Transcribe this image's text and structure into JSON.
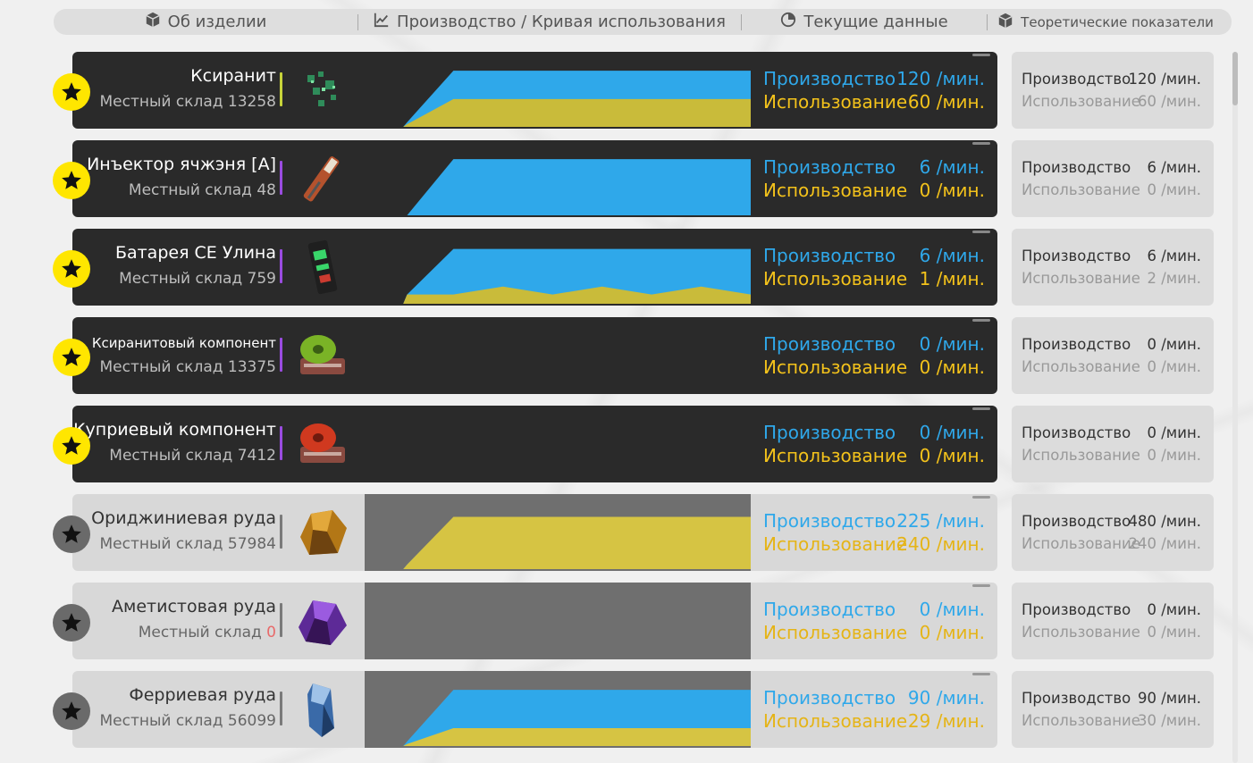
{
  "tabs": [
    {
      "icon": "box-icon",
      "label": "Об изделии"
    },
    {
      "icon": "line-chart-icon",
      "label": "Производство / Кривая использования"
    },
    {
      "icon": "pie-chart-icon",
      "label": "Текущие данные"
    },
    {
      "icon": "cube-icon",
      "label": "Теоретические показатели"
    }
  ],
  "colors": {
    "production": "#2fa8ea",
    "usage": "#f3c21b",
    "favorite_active": "#ffe600"
  },
  "items": [
    {
      "name": "Ксиранит",
      "stock_label": "Местный склад",
      "stock": "13258",
      "icon": "xiranite-crystal-icon",
      "production_label": "Производство",
      "production": "120",
      "usage_label": "Использование",
      "usage": "60",
      "unit": "/мин.",
      "theo_production": "120",
      "theo_usage": "60",
      "favorite": true,
      "curve": {
        "production": [
          0,
          0,
          0.07,
          0.85,
          0.85,
          0.85,
          0.85
        ],
        "usage": [
          0,
          0,
          0.04,
          0.42,
          0.42,
          0.42,
          0.42
        ]
      }
    },
    {
      "name": "Инъектор ячжэня [A]",
      "stock_label": "Местный склад",
      "stock": "48",
      "icon": "injector-icon",
      "production_label": "Производство",
      "production": "6",
      "usage_label": "Использование",
      "usage": "0",
      "unit": "/мин.",
      "theo_production": "6",
      "theo_usage": "0",
      "favorite": true,
      "curve": {
        "production": [
          0,
          0,
          0,
          0.85,
          0.85,
          0.85,
          0.85
        ],
        "usage": [
          0,
          0,
          0,
          0,
          0,
          0,
          0
        ]
      }
    },
    {
      "name": "Батарея СЕ Улина",
      "stock_label": "Местный склад",
      "stock": "759",
      "icon": "battery-icon",
      "production_label": "Производство",
      "production": "6",
      "usage_label": "Использование",
      "usage": "1",
      "unit": "/мин.",
      "theo_production": "6",
      "theo_usage": "2",
      "favorite": true,
      "curve": {
        "production": [
          0,
          0,
          0.14,
          0.83,
          0.83,
          0.83,
          0.83,
          0.83,
          0.83,
          0.83
        ],
        "usage": [
          0,
          0,
          0.14,
          0.14,
          0.26,
          0.14,
          0.26,
          0.14,
          0.26,
          0.14
        ]
      }
    },
    {
      "name": "Ксиранитовый компонент",
      "stock_label": "Местный склад",
      "stock": "13375",
      "icon": "xiranite-component-icon",
      "production_label": "Производство",
      "production": "0",
      "usage_label": "Использование",
      "usage": "0",
      "unit": "/мин.",
      "theo_production": "0",
      "theo_usage": "0",
      "favorite": true,
      "curve": null
    },
    {
      "name": "Куприевый компонент",
      "stock_label": "Местный склад",
      "stock": "7412",
      "icon": "cuprium-component-icon",
      "production_label": "Производство",
      "production": "0",
      "usage_label": "Использование",
      "usage": "0",
      "unit": "/мин.",
      "theo_production": "0",
      "theo_usage": "0",
      "favorite": true,
      "curve": null
    },
    {
      "name": "Ориджиниевая руда",
      "stock_label": "Местный склад",
      "stock": "57984",
      "icon": "originium-ore-icon",
      "production_label": "Производство",
      "production": "225",
      "usage_label": "Использование",
      "usage": "240",
      "unit": "/мин.",
      "theo_production": "480",
      "theo_usage": "240",
      "favorite": false,
      "curve": {
        "production": [
          0,
          0,
          0.07,
          0.78,
          0.79,
          0.76,
          0.73,
          0.72
        ],
        "usage": [
          0,
          0,
          0.07,
          0.79,
          0.79,
          0.79,
          0.79,
          0.79
        ]
      }
    },
    {
      "name": "Аметистовая руда",
      "stock_label": "Местный склад",
      "stock": "0",
      "icon": "amethyst-ore-icon",
      "production_label": "Производство",
      "production": "0",
      "usage_label": "Использование",
      "usage": "0",
      "unit": "/мин.",
      "theo_production": "0",
      "theo_usage": "0",
      "favorite": false,
      "curve": null
    },
    {
      "name": "Ферриевая руда",
      "stock_label": "Местный склад",
      "stock": "56099",
      "icon": "ferrium-ore-icon",
      "production_label": "Производство",
      "production": "90",
      "usage_label": "Использование",
      "usage": "29",
      "unit": "/мин.",
      "theo_production": "90",
      "theo_usage": "30",
      "favorite": false,
      "curve": {
        "production": [
          0,
          0,
          0.07,
          0.85,
          0.85,
          0.85,
          0.85
        ],
        "usage": [
          0,
          0,
          0.03,
          0.27,
          0.27,
          0.27,
          0.27
        ]
      }
    }
  ]
}
